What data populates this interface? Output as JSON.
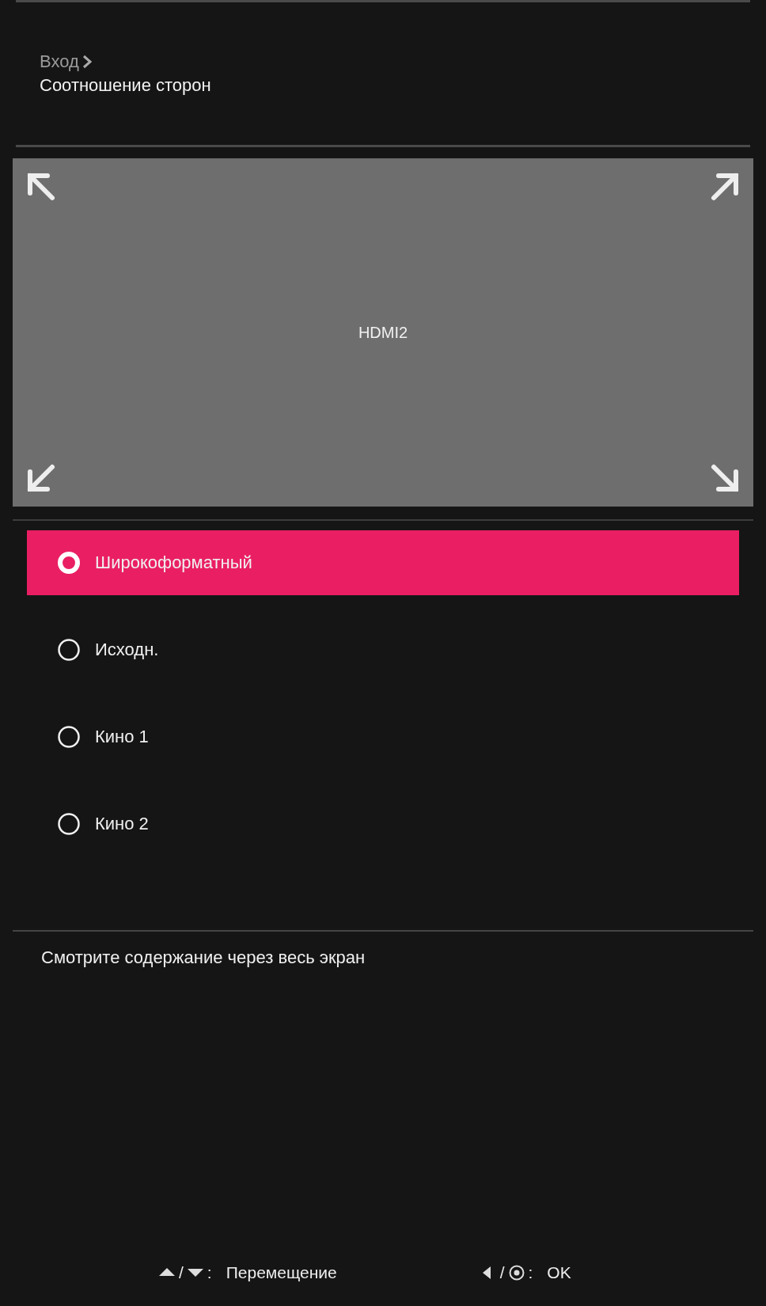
{
  "breadcrumb": {
    "parent": "Вход",
    "title": "Соотношение сторон"
  },
  "preview": {
    "source": "HDMI2"
  },
  "options": [
    {
      "label": "Широкоформатный",
      "selected": true
    },
    {
      "label": "Исходн.",
      "selected": false
    },
    {
      "label": "Кино 1",
      "selected": false
    },
    {
      "label": "Кино 2",
      "selected": false
    }
  ],
  "description": "Смотрите содержание через весь экран",
  "footer_hints": [
    {
      "kind": "up-down",
      "separator": "/",
      "colon": ":",
      "action": "Перемещение"
    },
    {
      "kind": "left-enter",
      "separator": "/",
      "colon": ":",
      "action": "OK"
    }
  ]
}
